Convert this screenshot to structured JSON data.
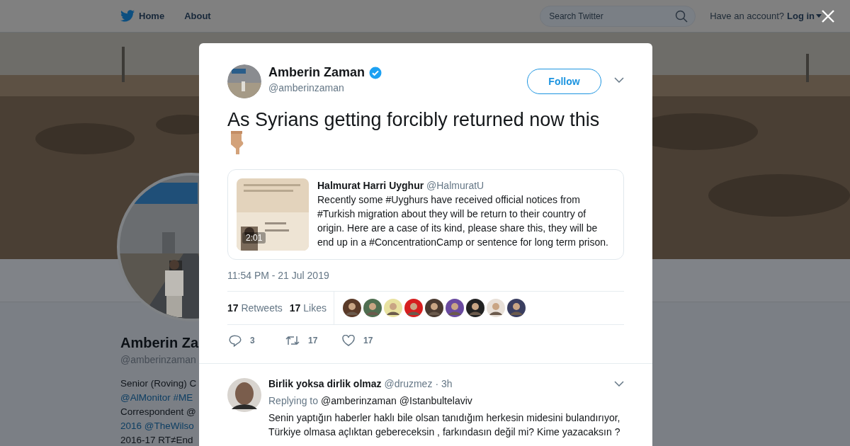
{
  "nav": {
    "items": [
      {
        "label": "Home",
        "kind": "home"
      },
      {
        "label": "About",
        "kind": "plain"
      }
    ],
    "search": {
      "placeholder": "Search Twitter"
    },
    "account_prompt": "Have an account?",
    "login": "Log in"
  },
  "profile": {
    "name": "Amberin Za",
    "handle": "@amberinzaman",
    "bio_lines": [
      {
        "text": "Senior (Roving) C",
        "kind": "plain"
      },
      {
        "text": "@AlMonitor #ME",
        "kind": "link"
      },
      {
        "text": "Correspondent @",
        "kind": "plain"
      },
      {
        "text": "2016 @TheWilso",
        "kind": "link"
      },
      {
        "text": "2016-17 RT≠End",
        "kind": "plain"
      }
    ]
  },
  "tweet": {
    "author": {
      "name": "Amberin Zaman",
      "handle": "@amberinzaman",
      "verified": true
    },
    "follow_button": "Follow",
    "text": "As Syrians getting forcibly returned now this",
    "quoted": {
      "name": "Halmurat Harri Uyghur",
      "handle": "@HalmuratU",
      "video_duration": "2:01",
      "text": "Recently some #Uyghurs have received official notices from #Turkish migration about they will be return to their country of origin. Here are a case of its kind, please share this, they will be end up in a #ConcentrationCamp or sentence for long term prison."
    },
    "timestamp": "11:54 PM - 21 Jul 2019",
    "stats": [
      {
        "count": "17",
        "label": "Retweets"
      },
      {
        "count": "17",
        "label": "Likes"
      }
    ],
    "likers": [
      {
        "color": "#5a3a28"
      },
      {
        "color": "#4f6e50"
      },
      {
        "color": "#e8e2a0"
      },
      {
        "color": "#d61f1f"
      },
      {
        "color": "#4a3a30"
      },
      {
        "color": "#6a4aa0"
      },
      {
        "color": "#222222"
      },
      {
        "color": "#e8e0d8"
      },
      {
        "color": "#3a3e60"
      }
    ],
    "actions": [
      {
        "kind": "reply",
        "count": "3"
      },
      {
        "kind": "retweet",
        "count": "17"
      },
      {
        "kind": "like",
        "count": "17"
      }
    ]
  },
  "replies": [
    {
      "name": "Birlik yoksa dirlik olmaz",
      "handle": "@druzmez",
      "time": "· 3h",
      "replying_label": "Replying to",
      "mentions": [
        "@amberinzaman",
        "@Istanbultelaviv"
      ],
      "text": "Senin yaptığın haberler haklı bile olsan tanıdığım herkesin midesini bulandırıyor, Türkiye olmasa açlıktan gebereceksin , farkındasın değil mi? Kime yazacaksın ?"
    }
  ]
}
